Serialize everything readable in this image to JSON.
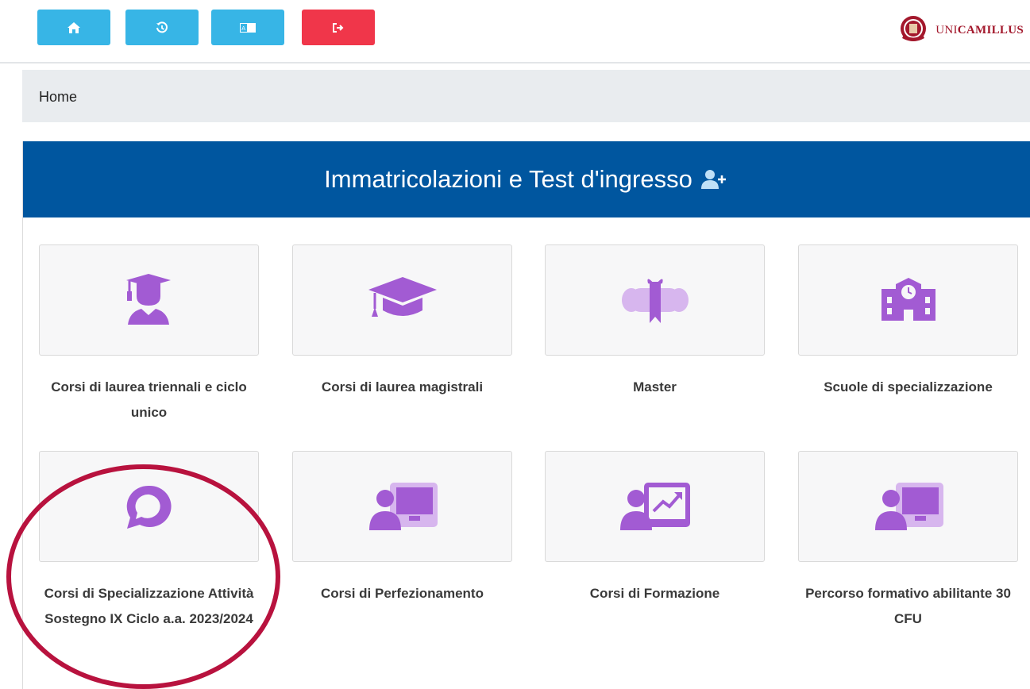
{
  "toolbar": {
    "buttons": [
      {
        "name": "home-button",
        "icon": "home-icon",
        "color": "#37b5e6"
      },
      {
        "name": "history-button",
        "icon": "history-icon",
        "color": "#37b5e6"
      },
      {
        "name": "language-button",
        "icon": "language-icon",
        "color": "#37b5e6"
      },
      {
        "name": "logout-button",
        "icon": "logout-icon",
        "color": "#f0364a"
      }
    ]
  },
  "brand": {
    "prefix": "UNI",
    "name": "CAMILLUS",
    "color": "#a3182c"
  },
  "breadcrumb": {
    "label": "Home"
  },
  "section": {
    "title": "Immatricolazioni e Test d'ingresso",
    "icon": "user-plus-icon",
    "color": "#00569f"
  },
  "accent_color": "#a25bd3",
  "cards": [
    {
      "label": "Corsi di laurea triennali e ciclo unico",
      "icon": "graduate-student-icon"
    },
    {
      "label": "Corsi di laurea magistrali",
      "icon": "graduation-cap-icon"
    },
    {
      "label": "Master",
      "icon": "diploma-scroll-icon"
    },
    {
      "label": "Scuole di specializzazione",
      "icon": "school-building-icon"
    },
    {
      "label": "Corsi di Specializzazione Attività Sostegno IX Ciclo a.a. 2023/2024",
      "icon": "speech-bubble-icon"
    },
    {
      "label": "Corsi di Perfezionamento",
      "icon": "teacher-board-icon"
    },
    {
      "label": "Corsi di Formazione",
      "icon": "presentation-chart-icon"
    },
    {
      "label": "Percorso formativo abilitante 30 CFU",
      "icon": "teacher-board-icon"
    }
  ],
  "highlight": {
    "target": "Corsi di Specializzazione Attività Sostegno IX Ciclo a.a. 2023/2024",
    "color": "#b8123e"
  }
}
